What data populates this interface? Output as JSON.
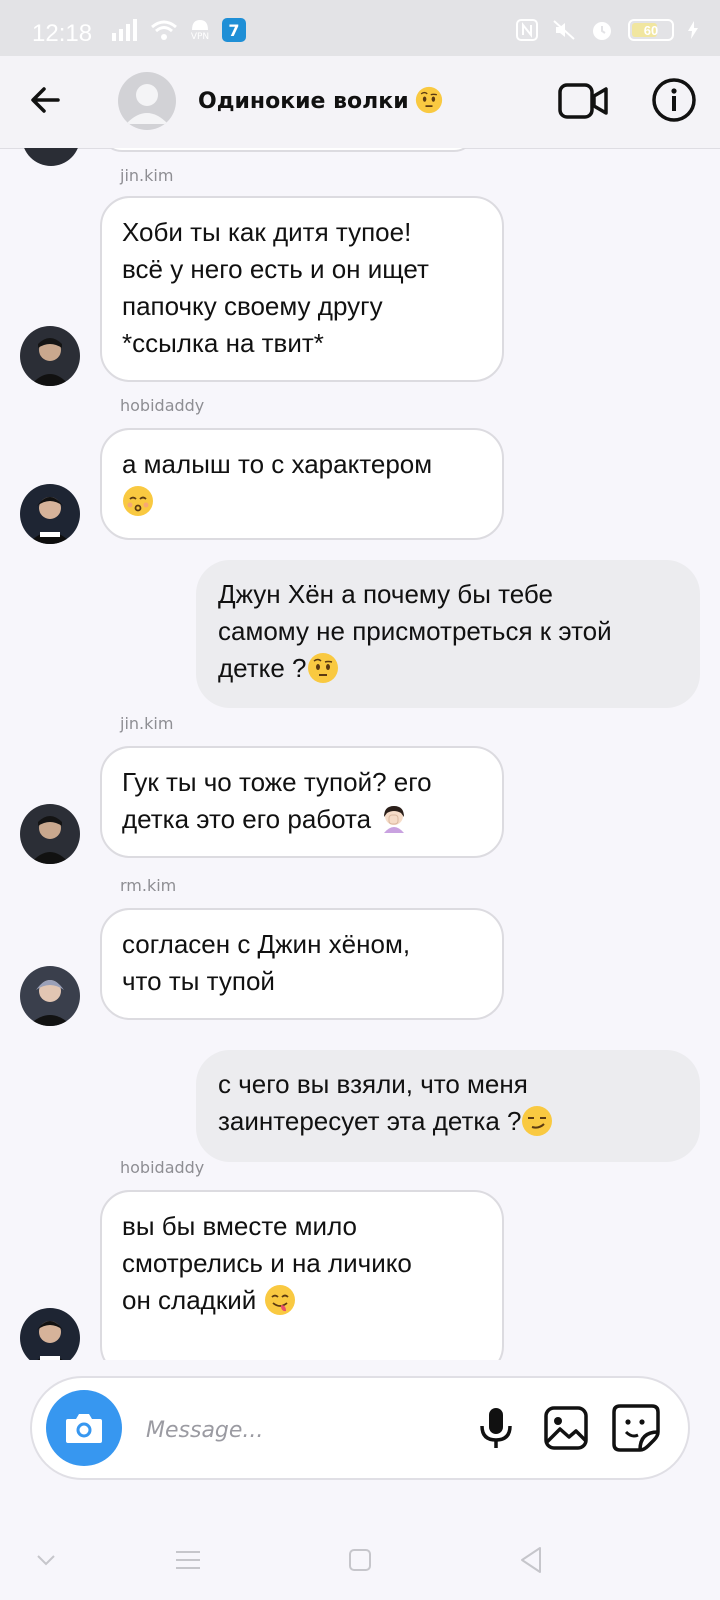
{
  "status_bar": {
    "time": "12:18",
    "battery": "60",
    "vpn_label": "VPN",
    "app_badge": "7"
  },
  "header": {
    "title": "Одинокие волки",
    "title_emoji": "face-with-raised-eyebrow-emoji"
  },
  "messages": [
    {
      "sender": "jin.kim",
      "direction": "incoming",
      "lines": [
        "Хоби ты как дитя тупое!",
        "всё у него есть и он ищет",
        "папочку своему другу",
        "*ссылка на твит*"
      ]
    },
    {
      "sender": "hobidaddy",
      "direction": "incoming",
      "lines": [
        "а малыш то с характером"
      ],
      "emoji": "kissing-face-emoji"
    },
    {
      "sender": "",
      "direction": "outgoing",
      "lines": [
        "Джун Хён а почему бы тебе",
        "самому не присмотреться к этой",
        "детке ?"
      ],
      "emoji": "face-with-raised-eyebrow-emoji"
    },
    {
      "sender": "jin.kim",
      "direction": "incoming",
      "lines": [
        "Гук ты чо тоже тупой? его",
        "детка это его работа"
      ],
      "emoji": "woman-facepalming-emoji"
    },
    {
      "sender": "rm.kim",
      "direction": "incoming",
      "lines": [
        "согласен с Джин хёном,",
        "что ты тупой"
      ]
    },
    {
      "sender": "",
      "direction": "outgoing",
      "lines": [
        "с чего вы взяли, что меня",
        "заинтересует эта детка ?"
      ],
      "emoji": "smirking-face-emoji"
    },
    {
      "sender": "hobidaddy",
      "direction": "incoming",
      "lines": [
        "вы бы вместе мило",
        "смотрелись и на личико",
        "он сладкий"
      ],
      "emoji": "face-savoring-food-emoji"
    }
  ],
  "composer": {
    "placeholder": "Message..."
  },
  "colors": {
    "accent": "#3797f0",
    "incoming_bubble": "#ffffff",
    "outgoing_bubble": "#ececef",
    "status_bar": "#e3e3e6"
  }
}
